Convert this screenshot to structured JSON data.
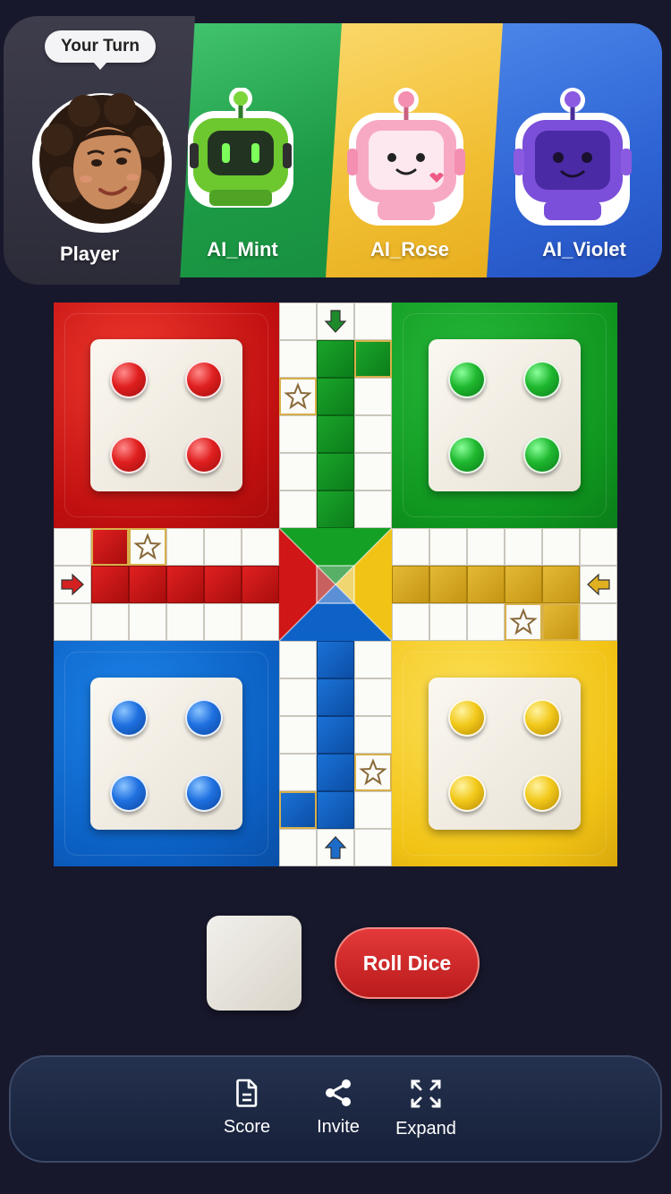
{
  "header": {
    "turn_label": "Your Turn",
    "players": [
      {
        "name": "Player",
        "color": "#2f2e3b",
        "avatar": "girl-avatar"
      },
      {
        "name": "AI_Mint",
        "color": "#1e9b45",
        "avatar": "green-robot-avatar"
      },
      {
        "name": "AI_Rose",
        "color": "#f1be32",
        "avatar": "pink-robot-avatar"
      },
      {
        "name": "AI_Violet",
        "color": "#2d63d4",
        "avatar": "purple-robot-avatar"
      }
    ]
  },
  "board": {
    "colors": {
      "red": "#d01616",
      "green": "#13a024",
      "blue": "#0e62c7",
      "yellow": "#f1c315"
    },
    "tokens_in_base": {
      "red": 4,
      "green": 4,
      "blue": 4,
      "yellow": 4
    }
  },
  "controls": {
    "roll_label": "Roll Dice",
    "dice_face": "blank"
  },
  "bottom_nav": {
    "items": [
      {
        "label": "Score",
        "icon": "document-icon"
      },
      {
        "label": "Invite",
        "icon": "share-icon"
      },
      {
        "label": "Expand",
        "icon": "expand-icon"
      }
    ]
  }
}
